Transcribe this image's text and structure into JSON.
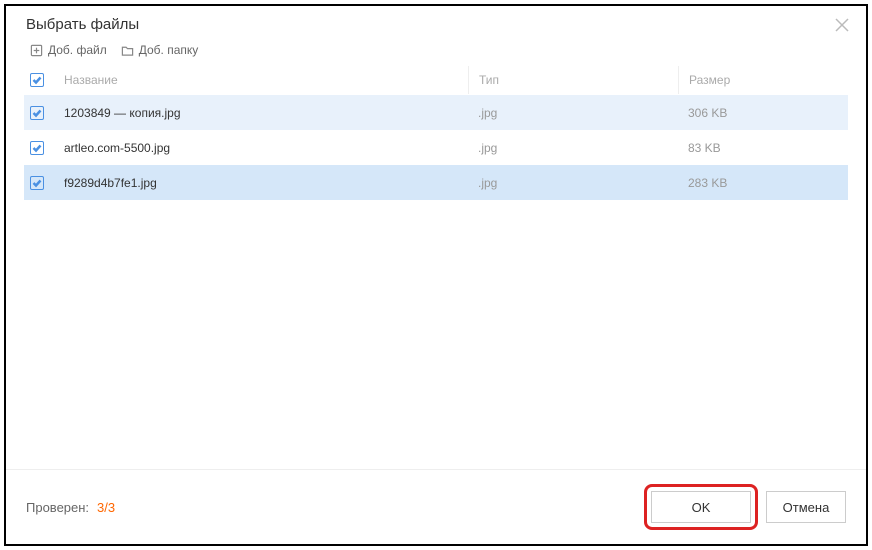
{
  "header": {
    "title": "Выбрать файлы"
  },
  "toolbar": {
    "add_file": "Доб. файл",
    "add_folder": "Доб. папку"
  },
  "columns": {
    "name": "Название",
    "type": "Тип",
    "size": "Размер"
  },
  "rows": [
    {
      "name": "1203849 — копия.jpg",
      "type": ".jpg",
      "size": "306 KB"
    },
    {
      "name": "artleo.com-5500.jpg",
      "type": ".jpg",
      "size": "83 KB"
    },
    {
      "name": "f9289d4b7fe1.jpg",
      "type": ".jpg",
      "size": "283 KB"
    }
  ],
  "footer": {
    "checked_label": "Проверен:",
    "checked_value": "3/3",
    "ok": "OK",
    "cancel": "Отмена"
  }
}
